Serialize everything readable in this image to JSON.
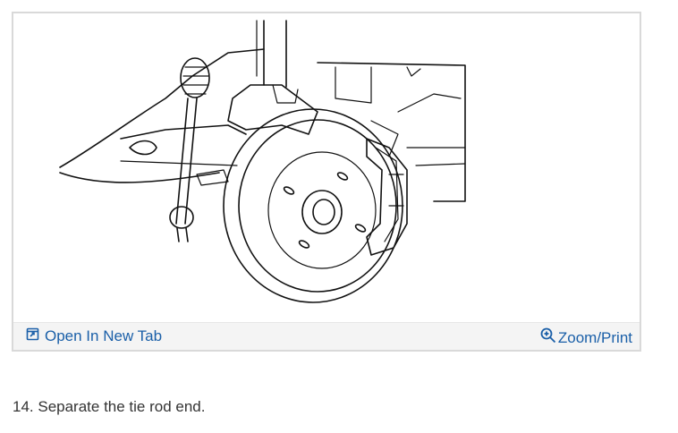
{
  "figure": {
    "open_new_tab_label": "Open In New Tab",
    "zoom_print_label": "Zoom/Print",
    "link_color": "#1a5fa8",
    "icons": {
      "open": "open-in-new-tab-icon",
      "zoom": "zoom-in-icon"
    }
  },
  "step": {
    "text": "14. Separate the tie rod end."
  }
}
